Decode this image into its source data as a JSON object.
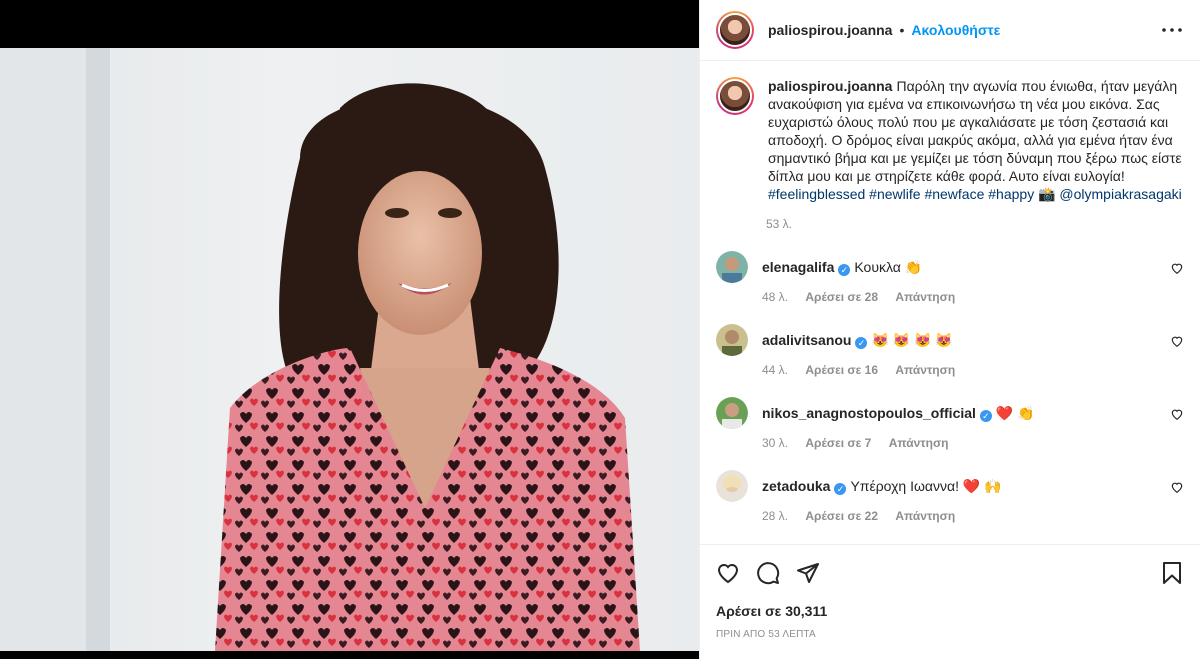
{
  "post": {
    "username": "paliospirou.joanna",
    "follow_label": "Ακολουθήστε",
    "separator": "•"
  },
  "caption": {
    "username": "paliospirou.joanna",
    "text": "Παρόλη την αγωνία που ένιωθα, ήταν μεγάλη ανακούφιση για εμένα να επικοινωνήσω τη νέα μου εικόνα. Σας ευχαριστώ όλους πολύ που με αγκαλιάσατε με τόση ζεστασιά και αποδοχή. Ο δρόμος είναι μακρύς ακόμα, αλλά για εμένα ήταν ένα σημαντικό βήμα και με γεμίζει με τόση δύναμη που ξέρω πως είστε δίπλα μου και με στηρίζετε κάθε φορά. Αυτο είναι ευλογία!",
    "tags": "#feelingblessed #newlife #newface #happy 📸 @olympiakrasagaki",
    "age": "53 λ."
  },
  "comments": [
    {
      "username": "elenagalifa",
      "text": "Κουκλα 👏",
      "age": "48 λ.",
      "likes": "Αρέσει σε 28",
      "reply": "Απάντηση"
    },
    {
      "username": "adalivitsanou",
      "text": "😻 😻 😻 😻",
      "age": "44 λ.",
      "likes": "Αρέσει σε 16",
      "reply": "Απάντηση"
    },
    {
      "username": "nikos_anagnostopoulos_official",
      "text": "❤️ 👏",
      "age": "30 λ.",
      "likes": "Αρέσει σε 7",
      "reply": "Απάντηση"
    },
    {
      "username": "zetadouka",
      "text": "Υπέροχη Ιωαννα! ❤️ 🙌",
      "age": "28 λ.",
      "likes": "Αρέσει σε 22",
      "reply": "Απάντηση"
    }
  ],
  "engagement": {
    "likes": "Αρέσει σε 30,311",
    "timestamp": "ΠΡΙΝ ΑΠΟ 53 ΛΕΠΤΑ"
  },
  "icons": {
    "like": "heart-icon",
    "comment": "comment-icon",
    "share": "share-icon",
    "save": "bookmark-icon",
    "more": "more-options-icon"
  },
  "colors": {
    "accent": "#0095f6",
    "text": "#262626",
    "muted": "#8e8e8e",
    "verified": "#3897f0"
  }
}
